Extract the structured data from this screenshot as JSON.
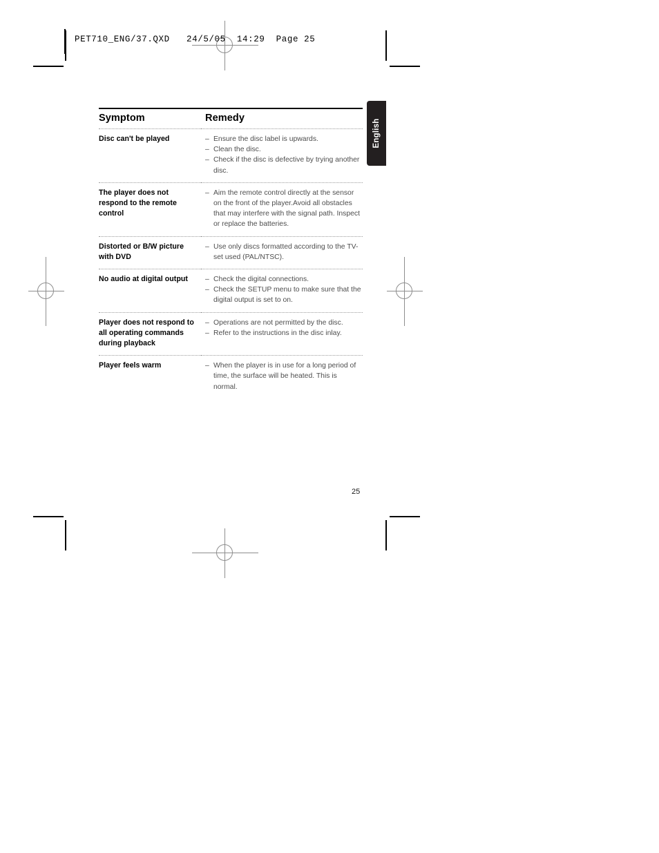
{
  "print_slug": {
    "text": "PET710_ENG/37.QXD   24/5/05  14:29  Page 25"
  },
  "side_tab": {
    "label": "English"
  },
  "table": {
    "columns": [
      "Symptom",
      "Remedy"
    ],
    "rows": [
      {
        "symptom": "Disc can't be played",
        "remedies": [
          "Ensure the disc label is upwards.",
          "Clean the disc.",
          "Check if the disc is defective by trying another disc."
        ]
      },
      {
        "symptom": "The player does not respond to the remote control",
        "remedies": [
          "Aim the remote control directly at the sensor on the front of the player.Avoid all obstacles that may interfere with the signal path. Inspect or replace the batteries."
        ]
      },
      {
        "symptom": "Distorted or B/W picture with DVD",
        "remedies": [
          "Use only discs formatted according to the TV-set used (PAL/NTSC)."
        ]
      },
      {
        "symptom": "No audio at digital output",
        "remedies": [
          "Check the digital connections.",
          "Check the SETUP menu to make sure that the digital output is set to on."
        ]
      },
      {
        "symptom": "Player does not respond to all operating commands during playback",
        "remedies": [
          "Operations are not permitted by the disc.",
          "Refer to the instructions in the disc inlay."
        ]
      },
      {
        "symptom": "Player feels warm",
        "remedies": [
          "When the player is in use for a long period of time, the surface will be heated. This is normal."
        ]
      }
    ]
  },
  "folio": {
    "page_number": "25"
  },
  "marks": {
    "dash": "–"
  },
  "colors": {
    "rule": "#000000",
    "row_separator": "#9a9a9a",
    "body_text": "#4d4d4d",
    "tab_background": "#231f20",
    "tab_text": "#ffffff",
    "registration": "#8d8d8d"
  }
}
